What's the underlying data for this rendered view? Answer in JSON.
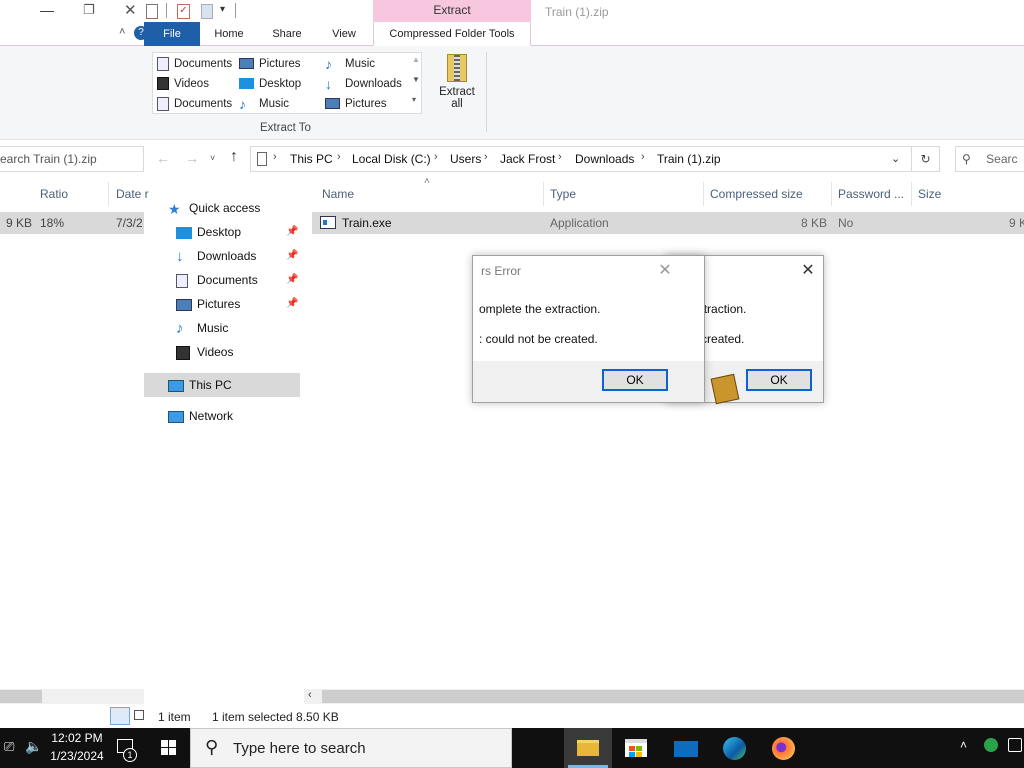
{
  "window": {
    "title": "Train (1).zip",
    "context_tab_group": "Extract"
  },
  "ribbon": {
    "tabs": [
      {
        "label": "File"
      },
      {
        "label": "Home"
      },
      {
        "label": "Share"
      },
      {
        "label": "View"
      },
      {
        "label": "Compressed Folder Tools"
      }
    ],
    "extract_to": {
      "label": "Extract To",
      "items": [
        {
          "label": "Documents",
          "icon": "documents-icon"
        },
        {
          "label": "Videos",
          "icon": "videos-icon"
        },
        {
          "label": "Documents",
          "icon": "documents-icon"
        },
        {
          "label": "Pictures",
          "icon": "pictures-icon"
        },
        {
          "label": "Desktop",
          "icon": "desktop-icon"
        },
        {
          "label": "Music",
          "icon": "music-icon"
        },
        {
          "label": "Music",
          "icon": "music-icon"
        },
        {
          "label": "Downloads",
          "icon": "downloads-icon"
        },
        {
          "label": "Pictures",
          "icon": "pictures-icon"
        }
      ]
    },
    "extract_all": {
      "line1": "Extract",
      "line2": "all"
    }
  },
  "address": {
    "crumbs": [
      "This PC",
      "Local Disk (C:)",
      "Users",
      "Jack Frost",
      "Downloads",
      "Train (1).zip"
    ],
    "search_placeholder_left": "earch Train (1).zip",
    "search_placeholder_right": "Searc"
  },
  "left_fragment": {
    "headers": [
      "Ratio",
      "Date r"
    ],
    "row": {
      "size": "9 KB",
      "ratio": "18%",
      "date": "7/3/2"
    }
  },
  "nav": {
    "items": [
      {
        "label": "Quick access",
        "icon": "quick-access-star-icon",
        "pinned": false
      },
      {
        "label": "Desktop",
        "icon": "desktop-icon",
        "pinned": true
      },
      {
        "label": "Downloads",
        "icon": "downloads-icon",
        "pinned": true
      },
      {
        "label": "Documents",
        "icon": "documents-icon",
        "pinned": true
      },
      {
        "label": "Pictures",
        "icon": "pictures-icon",
        "pinned": true
      },
      {
        "label": "Music",
        "icon": "music-icon",
        "pinned": false
      },
      {
        "label": "Videos",
        "icon": "videos-icon",
        "pinned": false
      },
      {
        "label": "This PC",
        "icon": "this-pc-icon",
        "pinned": false
      },
      {
        "label": "Network",
        "icon": "network-icon",
        "pinned": false
      }
    ]
  },
  "file_list": {
    "columns": [
      "Name",
      "Type",
      "Compressed size",
      "Password ...",
      "Size"
    ],
    "rows": [
      {
        "name": "Train.exe",
        "type": "Application",
        "compressed_size": "8 KB",
        "password": "No",
        "size": "9 K"
      }
    ]
  },
  "status": {
    "count": "1 item",
    "selected": "1 item selected  8.50 KB"
  },
  "dialogs": [
    {
      "title": "rs Error",
      "line1": "omplete the extraction.",
      "line2": ": could not be created.",
      "ok": "OK"
    },
    {
      "line1": "the extraction.",
      "line2": "ot be created.",
      "ok": "OK"
    }
  ],
  "taskbar": {
    "search_placeholder": "Type here to search",
    "time": "12:02 PM",
    "date": "1/23/2024",
    "apps": [
      "file-explorer-icon",
      "store-icon",
      "mail-icon",
      "edge-icon",
      "firefox-icon"
    ],
    "notification_count": "1"
  },
  "colors": {
    "file_tab": "#1f5fa8",
    "context_tab": "#f7c6df",
    "selection": "#d9d9d9",
    "taskbar": "#101010",
    "focus_border": "#0a64d4"
  }
}
